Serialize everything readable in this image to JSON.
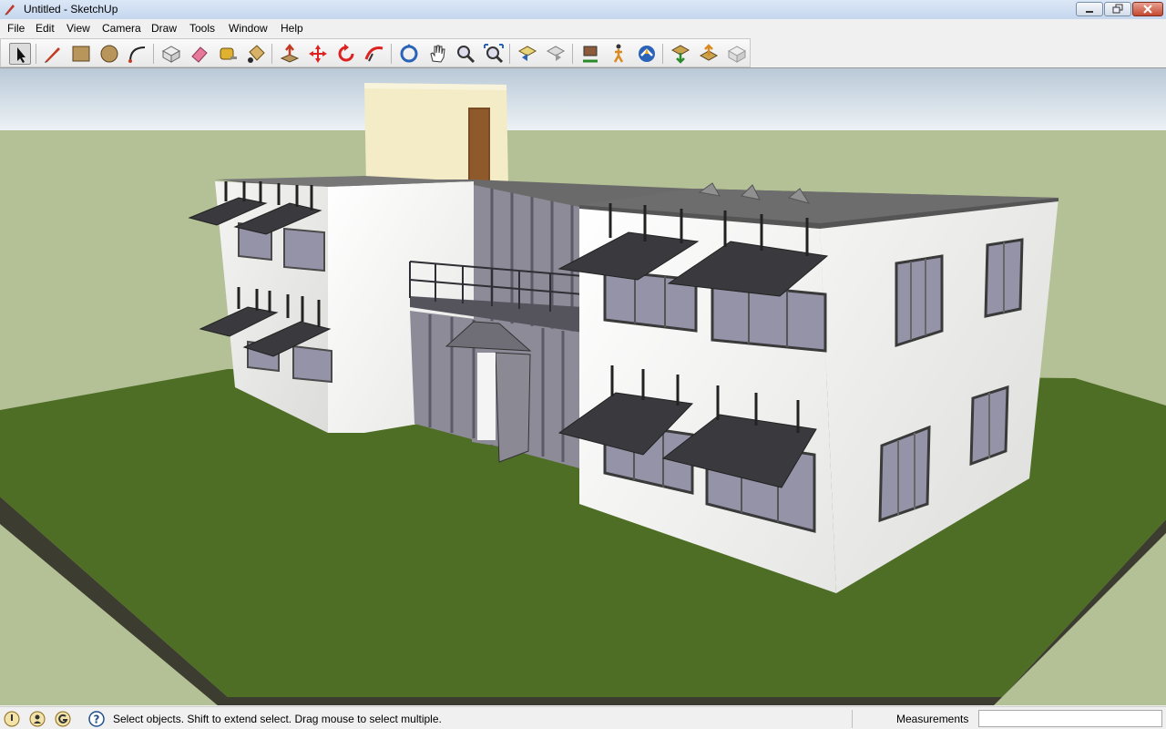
{
  "window": {
    "title": "Untitled - SketchUp"
  },
  "menu": [
    "File",
    "Edit",
    "View",
    "Camera",
    "Draw",
    "Tools",
    "Window",
    "Help"
  ],
  "toolbar": {
    "tools": [
      "select-arrow-icon",
      "pencil-line-icon",
      "rectangle-icon",
      "circle-icon",
      "arc-icon",
      "make-component-icon",
      "eraser-icon",
      "tape-measure-icon",
      "paint-bucket-icon",
      "push-pull-icon",
      "move-icon",
      "rotate-icon",
      "follow-me-icon",
      "orbit-icon",
      "pan-hand-icon",
      "zoom-icon",
      "zoom-extents-icon",
      "previous-view-icon",
      "next-view-icon",
      "place-camera-icon",
      "walk-icon",
      "look-around-icon",
      "get-models-icon",
      "share-model-icon",
      "share-component-icon"
    ]
  },
  "status": {
    "hint": "Select objects. Shift to extend select. Drag mouse to select multiple.",
    "measurements_label": "Measurements",
    "measurements_value": ""
  },
  "colors": {
    "sky": "#dde7ee",
    "ground": "#b4c196",
    "grass": "#4a6b22",
    "wall": "#f1f1ef"
  }
}
